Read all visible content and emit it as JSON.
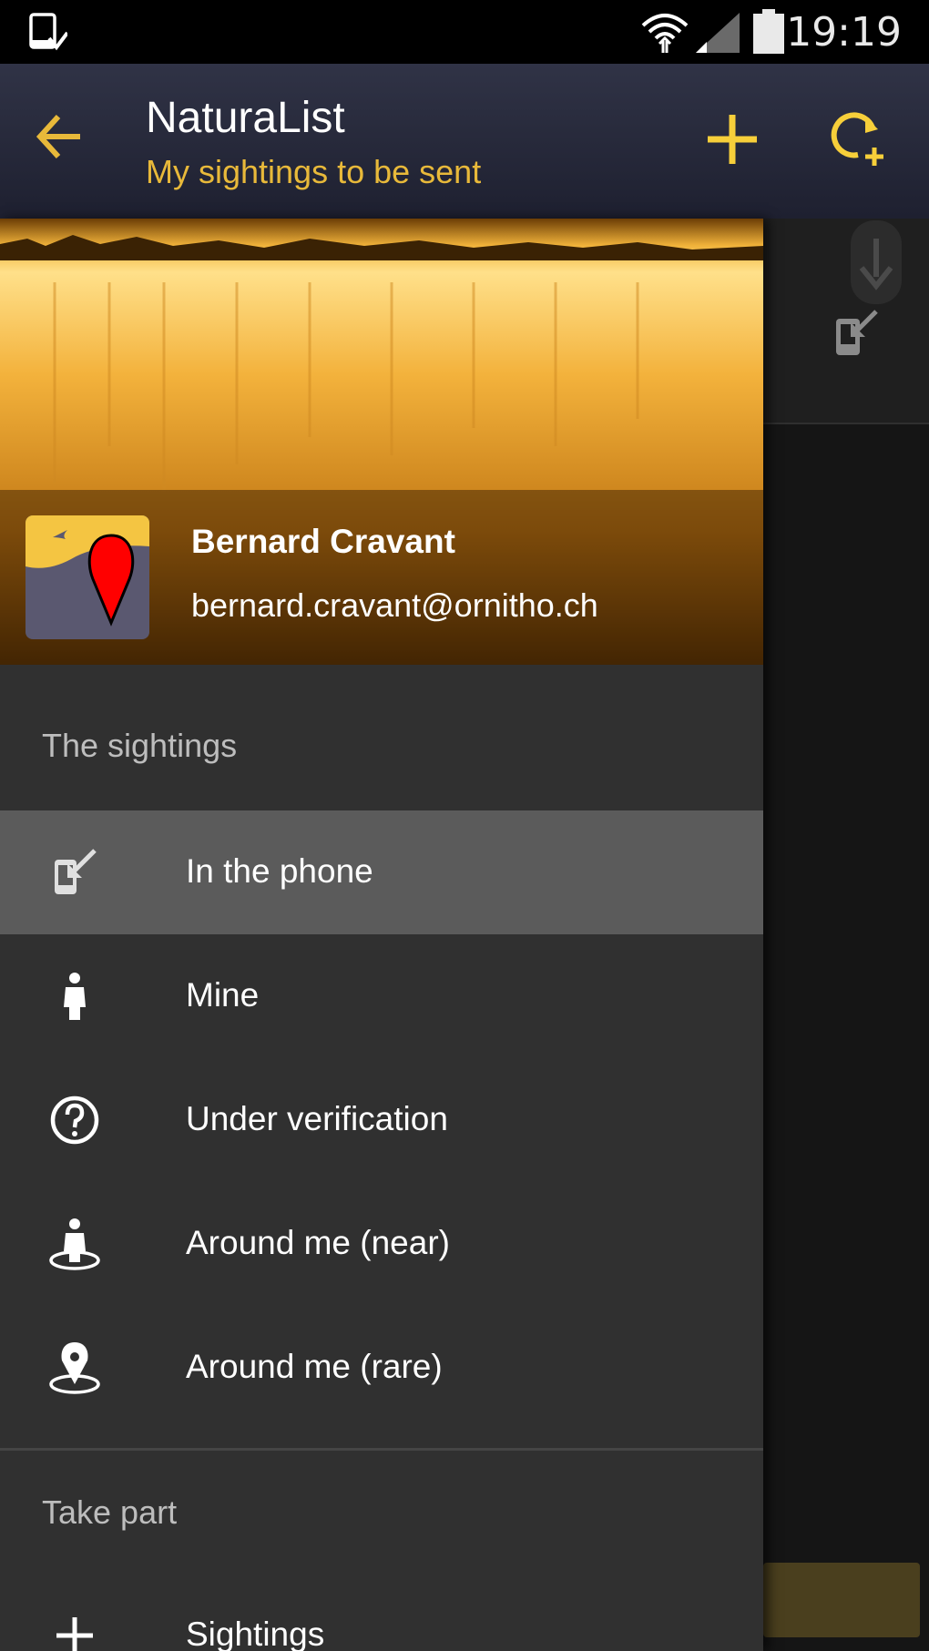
{
  "status_bar": {
    "time": "19:19",
    "icons": [
      "phone-download-icon",
      "wifi-icon",
      "signal-icon",
      "battery-icon"
    ]
  },
  "app_bar": {
    "title": "NaturaList",
    "subtitle": "My sightings to be sent",
    "actions": [
      "back-arrow-icon",
      "add-icon",
      "refresh-add-icon"
    ]
  },
  "drawer": {
    "user": {
      "name": "Bernard Cravant",
      "email": "bernard.cravant@ornitho.ch"
    },
    "sections": [
      {
        "heading": "The sightings",
        "items": [
          {
            "label": "In the phone",
            "icon": "phone-import-icon",
            "active": true
          },
          {
            "label": "Mine",
            "icon": "person-icon",
            "active": false
          },
          {
            "label": "Under verification",
            "icon": "question-circle-icon",
            "active": false
          },
          {
            "label": "Around me (near)",
            "icon": "person-radius-icon",
            "active": false
          },
          {
            "label": "Around me (rare)",
            "icon": "pin-radius-icon",
            "active": false
          }
        ]
      },
      {
        "heading": "Take part",
        "items": [
          {
            "label": "Sightings",
            "icon": "plus-icon",
            "active": false
          }
        ]
      }
    ]
  },
  "colors": {
    "accent": "#e8b93a",
    "appbar": "#292b3c",
    "drawer_bg": "#303030",
    "active_item": "#5b5b5b",
    "avatar_yellow": "#f4c542",
    "avatar_slate": "#5a5870",
    "pin_red": "#ff0000"
  }
}
